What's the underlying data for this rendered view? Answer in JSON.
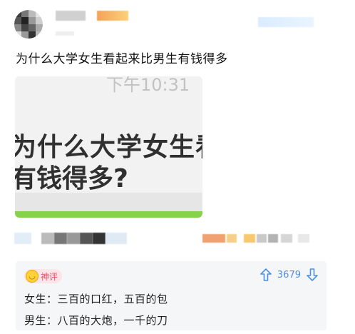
{
  "post": {
    "title": "为什么大学女生看起来比男生有钱得多"
  },
  "image_card": {
    "time_text": "下午10:31",
    "question_line1": "为什么大学女生看起来比",
    "question_line2": "有钱得多?"
  },
  "comment": {
    "badge_label": "神评",
    "vote_count": "3679",
    "lines": [
      "女生：三百的口红，五百的包",
      "男生：八百的大炮，一千的刀"
    ]
  },
  "colors": {
    "accent_blue": "#4a90e2",
    "badge_pink": "#e8506b",
    "progress_green": "#86d24a"
  },
  "icons": [
    "avatar",
    "smile-face-icon",
    "arrow-up-icon",
    "arrow-down-icon"
  ]
}
